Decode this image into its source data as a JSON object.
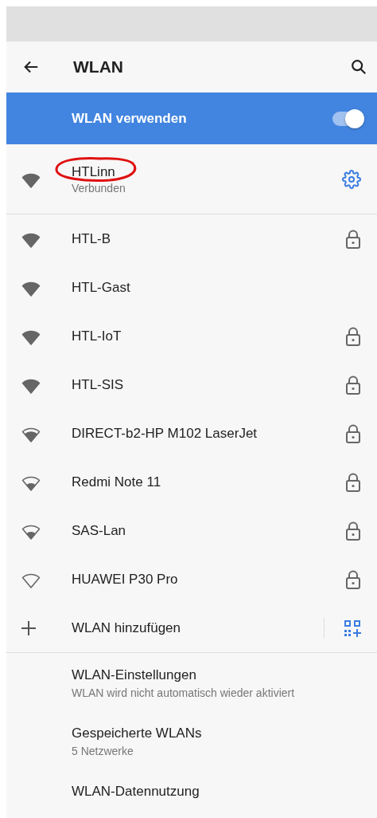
{
  "app_bar": {
    "title": "WLAN"
  },
  "master_switch": {
    "label": "WLAN verwenden",
    "on": true
  },
  "connected": {
    "name": "HTLinn",
    "status": "Verbunden",
    "kind": "full",
    "circled": true
  },
  "networks": [
    {
      "name": "HTL-B",
      "kind": "full",
      "locked": true
    },
    {
      "name": "HTL-Gast",
      "kind": "full",
      "locked": false
    },
    {
      "name": "HTL-IoT",
      "kind": "full",
      "locked": true
    },
    {
      "name": "HTL-SIS",
      "kind": "full",
      "locked": true
    },
    {
      "name": "DIRECT-b2-HP M102 LaserJet",
      "kind": "good",
      "locked": true
    },
    {
      "name": "Redmi Note 11",
      "kind": "fair",
      "locked": true
    },
    {
      "name": "SAS-Lan",
      "kind": "fair",
      "locked": true
    },
    {
      "name": "HUAWEI P30 Pro",
      "kind": "weak",
      "locked": true
    }
  ],
  "add_network": {
    "label": "WLAN hinzufügen"
  },
  "settings": [
    {
      "title": "WLAN-Einstellungen",
      "summary": "WLAN wird nicht automatisch wieder aktiviert"
    },
    {
      "title": "Gespeicherte WLANs",
      "summary": "5 Netzwerke"
    },
    {
      "title": "WLAN-Datennutzung"
    }
  ]
}
